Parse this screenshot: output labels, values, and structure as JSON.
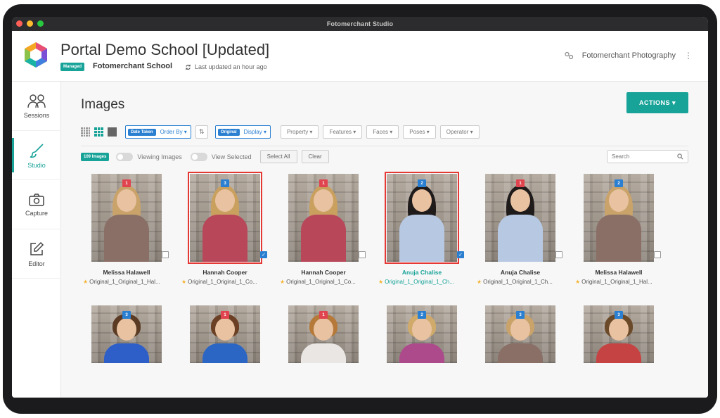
{
  "window_title": "Fotomerchant Studio",
  "header": {
    "title": "Portal Demo School [Updated]",
    "badge": "Managed",
    "school": "Fotomerchant School",
    "updated": "Last updated an hour ago",
    "org": "Fotomerchant Photography"
  },
  "sidebar": {
    "items": [
      {
        "label": "Sessions",
        "icon": "users-icon"
      },
      {
        "label": "Studio",
        "icon": "brush-icon",
        "active": true
      },
      {
        "label": "Capture",
        "icon": "camera-icon"
      },
      {
        "label": "Editor",
        "icon": "edit-icon"
      }
    ]
  },
  "main": {
    "title": "Images",
    "actions_label": "ACTIONS ▾",
    "order": {
      "chip": "Date Taken",
      "label": "Order By ▾"
    },
    "display": {
      "chip": "Original",
      "label": "Display ▾"
    },
    "filters": [
      "Property ▾",
      "Features ▾",
      "Faces ▾",
      "Poses ▾",
      "Operator ▾"
    ],
    "count": "109 Images",
    "viewing": "Viewing Images",
    "view_selected": "View Selected",
    "select_all": "Select All",
    "clear": "Clear",
    "search_placeholder": "Search"
  },
  "colors": {
    "accent": "#17a398",
    "blue": "#2a7fd1",
    "red": "#e53935"
  },
  "images": [
    {
      "name": "Melissa Halawell",
      "file": "Original_1_Original_1_Hal...",
      "pose": "1",
      "pose_color": "red",
      "selected": false
    },
    {
      "name": "Hannah Cooper",
      "file": "Original_1_Original_1_Co...",
      "pose": "3",
      "pose_color": "blue",
      "selected": true
    },
    {
      "name": "Hannah Cooper",
      "file": "Original_1_Original_1_Co...",
      "pose": "1",
      "pose_color": "red",
      "selected": false
    },
    {
      "name": "Anuja Chalise",
      "file": "Original_1_Original_1_Ch...",
      "pose": "2",
      "pose_color": "blue",
      "selected": true,
      "highlight": true
    },
    {
      "name": "Anuja Chalise",
      "file": "Original_1_Original_1_Ch...",
      "pose": "1",
      "pose_color": "red",
      "selected": false
    },
    {
      "name": "Melissa Halawell",
      "file": "Original_1_Original_1_Hal...",
      "pose": "2",
      "pose_color": "blue",
      "selected": false
    },
    {
      "pose": "3",
      "pose_color": "blue"
    },
    {
      "pose": "1",
      "pose_color": "red"
    },
    {
      "pose": "1",
      "pose_color": "red"
    },
    {
      "pose": "2",
      "pose_color": "blue"
    },
    {
      "pose": "3",
      "pose_color": "blue"
    },
    {
      "pose": "3",
      "pose_color": "blue"
    }
  ]
}
